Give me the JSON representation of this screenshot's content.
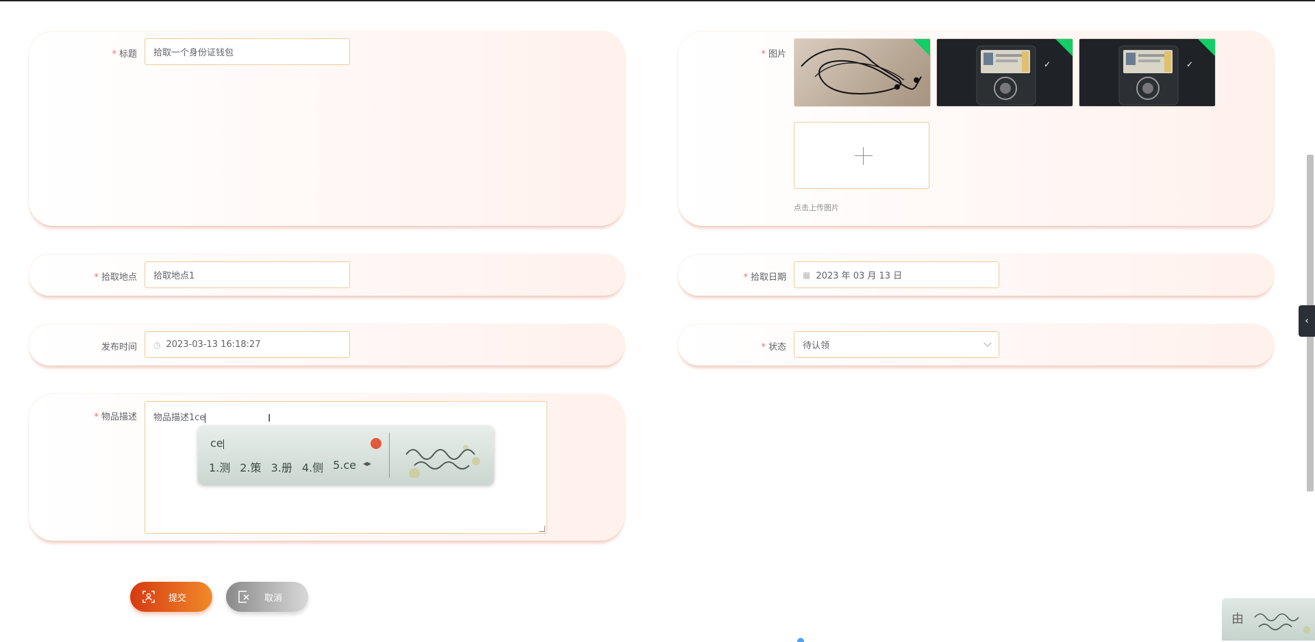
{
  "form": {
    "title": {
      "label": "标题",
      "value": "拾取一个身份证钱包"
    },
    "images": {
      "label": "图片",
      "upload_hint": "点击上传图片",
      "photos": [
        {
          "name": "earphones-photo",
          "uploaded": true
        },
        {
          "name": "id-wallet-photo-1",
          "uploaded": true
        },
        {
          "name": "id-wallet-photo-2",
          "uploaded": true
        }
      ]
    },
    "location": {
      "label": "拾取地点",
      "value": "拾取地点1"
    },
    "date": {
      "label": "拾取日期",
      "value": "2023 年 03 月 13 日",
      "icon": "calendar-icon"
    },
    "publish_time": {
      "label": "发布时间",
      "value": "2023-03-13 16:18:27",
      "icon": "clock-icon"
    },
    "status": {
      "label": "状态",
      "value": "待认领",
      "icon": "chevron-down-icon"
    },
    "description": {
      "label": "物品描述",
      "value": "物品描述1ce"
    }
  },
  "ime": {
    "composition": "ce",
    "candidates": [
      "1.测",
      "2.策",
      "3.册",
      "4.侧",
      "5.ce"
    ]
  },
  "buttons": {
    "submit": "提交",
    "cancel": "取消"
  },
  "colors": {
    "required": "#f56c6c",
    "submit_gradient": [
      "#d63a12",
      "#f08a2a"
    ],
    "cancel_gradient": [
      "#8a8a8a",
      "#d8d8d8"
    ],
    "uploaded_badge": "#13ce66"
  },
  "corner_widget": {
    "glyph": "由"
  }
}
